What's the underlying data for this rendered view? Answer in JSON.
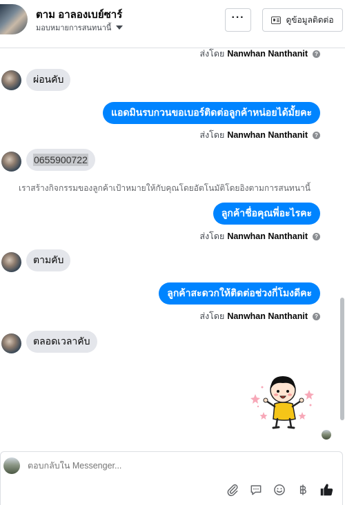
{
  "header": {
    "contact_name": "ตาม อาลองเบย์ซาร์",
    "assign_label": "มอบหมายการสนทนานี้",
    "more_label": "···",
    "contact_info_label": "ดูข้อมูลติดต่อ"
  },
  "messages": {
    "sent_by_prefix": "ส่งโดย",
    "agent_name": "Nanwhan Nanthanit",
    "help_glyph": "?",
    "in_1": "ผ่อนคับ",
    "out_1": "แอดมินรบกวนขอเบอร์ติดต่อลูกค้าหน่อยได้มั้ยคะ",
    "in_2": "0655900722",
    "system_note": "เราสร้างกิจกรรมของลูกค้าเป้าหมายให้กับคุณโดยอัตโนมัติโดยอิงตามการสนทนานี้",
    "out_2": "ลูกค้าชื่อคุณพี่อะไรคะ",
    "in_3": "ตามคับ",
    "out_3": "ลูกค้าสะดวกให้ติดต่อช่วงกี่โมงดีคะ",
    "in_4": "ตลอดเวลาคับ"
  },
  "composer": {
    "placeholder": "ตอบกลับใน Messenger..."
  },
  "icons": [
    "card-icon",
    "caret-down-icon",
    "help-icon",
    "paperclip-icon",
    "chat-bubble-icon",
    "smiley-icon",
    "baht-icon",
    "thumbs-up-icon"
  ],
  "colors": {
    "outgoing_bubble": "#0084ff",
    "incoming_bubble": "#e4e6eb",
    "border": "#dcdfe3"
  }
}
